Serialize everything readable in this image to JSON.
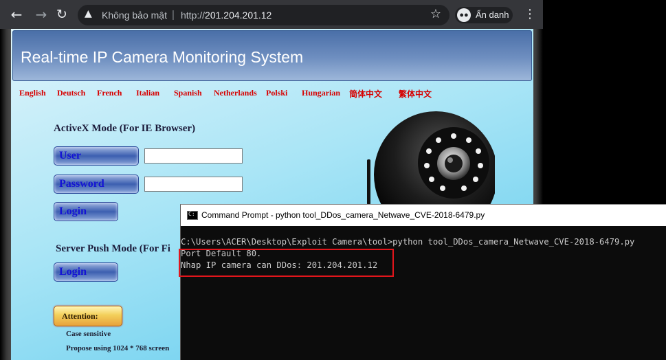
{
  "browser": {
    "security_label": "Không bảo mật",
    "separator": "|",
    "url_scheme": "http://",
    "url_host": "201.204.201.12",
    "incognito_label": "Ẩn danh",
    "icons": [
      "back-arrow-icon",
      "forward-arrow-icon",
      "reload-icon",
      "warning-icon",
      "star-icon",
      "incognito-icon",
      "menu-icon"
    ]
  },
  "page": {
    "title": "Real-time IP Camera Monitoring System",
    "languages": [
      "English",
      "Deutsch",
      "French",
      "Italian",
      "Spanish",
      "Netherlands",
      "Polski",
      "Hungarian",
      "简体中文",
      "繁体中文"
    ],
    "activex_title": "ActiveX Mode (For IE Browser)",
    "user_label": "User",
    "password_label": "Password",
    "user_value": "",
    "password_value": "",
    "login_label": "Login",
    "server_push_title": "Server Push Mode (For Fi",
    "server_login_label": "Login",
    "attention_label": "Attention:",
    "notes": [
      "Case sensitive",
      "Propose using 1024 * 768 screen"
    ]
  },
  "cmd": {
    "title": "Command Prompt - python  tool_DDos_camera_Netwave_CVE-2018-6479.py",
    "lines": [
      "C:\\Users\\ACER\\Desktop\\Exploit Camera\\tool>python tool_DDos_camera_Netwave_CVE-2018-6479.py",
      "Port Default 80.",
      "Nhap IP camera can DDos: 201.204.201.12"
    ]
  },
  "colors": {
    "language_link": "#d70000",
    "highlight_box": "#e2151b",
    "cmd_background": "#0c0c0c",
    "cmd_text": "#cccccc"
  }
}
